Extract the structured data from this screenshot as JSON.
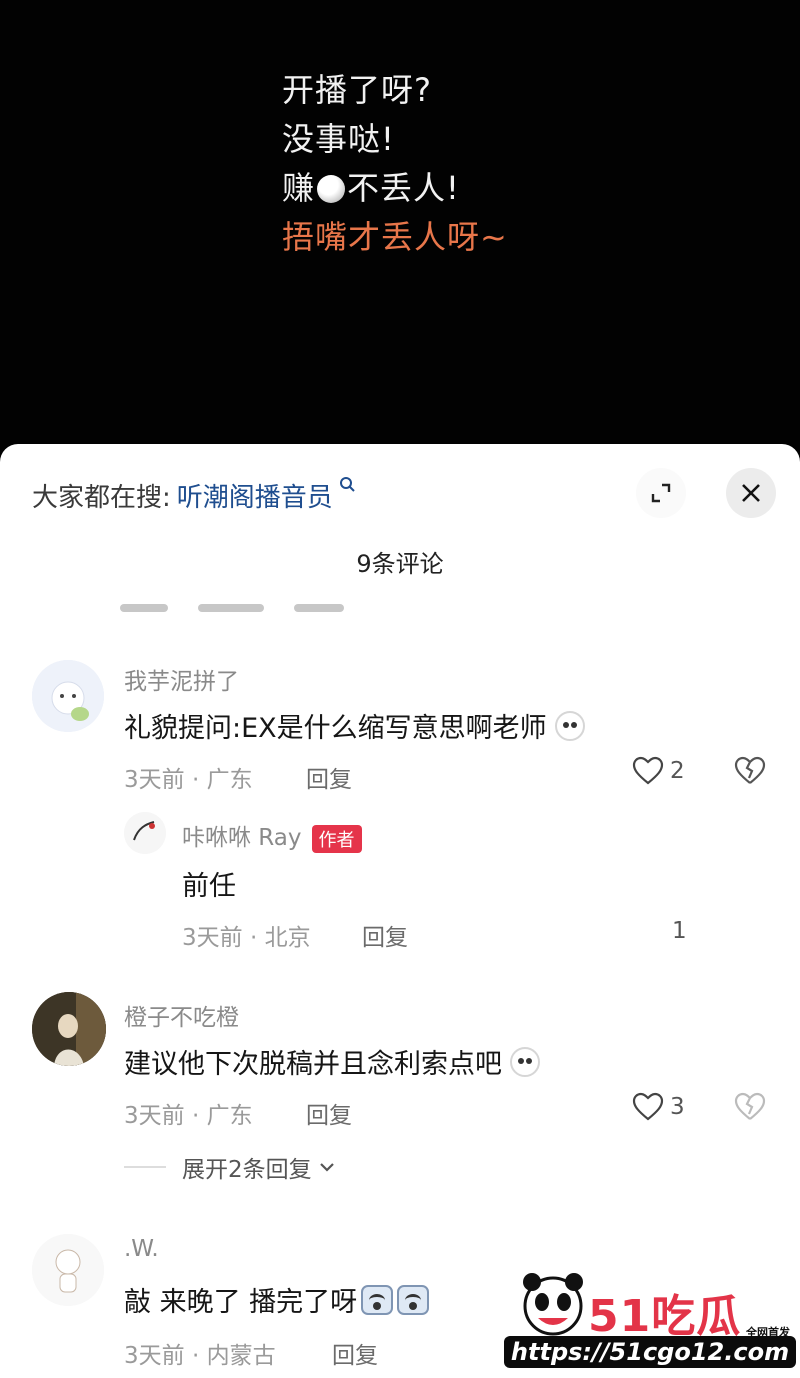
{
  "video": {
    "caption_lines": [
      "开播了呀?",
      "没事哒!",
      "赚",
      "不丢人!",
      "捂嘴才丢人呀~"
    ],
    "colors": {
      "caption": "#f2f2f2",
      "highlight": "#e8764a"
    }
  },
  "sheet": {
    "search_prefix": "大家都在搜:",
    "search_term": "听潮阁播音员",
    "comment_count": "9条评论",
    "icons": [
      "search-icon",
      "expand-icon",
      "close-icon"
    ]
  },
  "comments": [
    {
      "username": "我芋泥拼了",
      "text": "礼貌提问:EX是什么缩写意思啊老师",
      "time_location": "3天前 · 广东",
      "reply": "回复",
      "likes": "2"
    },
    {
      "username": "咔咻咻 Ray",
      "badge": "作者",
      "text": "前任",
      "time_location": "3天前 · 北京",
      "reply": "回复",
      "likes": "1"
    },
    {
      "username": "橙子不吃橙",
      "text": "建议他下次脱稿并且念利索点吧",
      "time_location": "3天前 · 广东",
      "reply": "回复",
      "likes": "3",
      "expand_replies": "展开2条回复"
    },
    {
      "username": ".W.",
      "text": "敲 来晚了 播完了呀",
      "time_location": "3天前 · 内蒙古",
      "reply": "回复"
    }
  ],
  "watermark": {
    "title": "51吃瓜",
    "small": "全网首发",
    "url": "https://51cgo12.com"
  },
  "colors": {
    "link": "#1f4e8f",
    "badge": "#e5344a",
    "meta": "#9a9a9a"
  }
}
